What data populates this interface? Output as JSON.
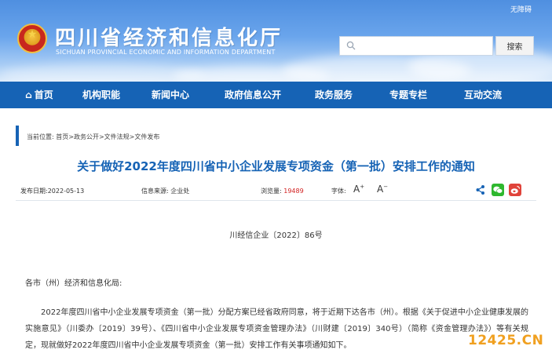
{
  "header": {
    "accessibility": "无障碍",
    "site_title": "四川省经济和信息化厅",
    "site_subtitle": "SICHUAN PROVINCIAL ECONOMIC AND INFORMATION DEPARTMENT",
    "search_placeholder": "",
    "search_button": "搜索"
  },
  "nav": {
    "items": [
      {
        "label": "首页",
        "icon": "home-icon"
      },
      {
        "label": "机构职能"
      },
      {
        "label": "新闻中心"
      },
      {
        "label": "政府信息公开"
      },
      {
        "label": "政务服务"
      },
      {
        "label": "专题专栏"
      },
      {
        "label": "互动交流"
      }
    ]
  },
  "breadcrumb": {
    "prefix": "当前位置:",
    "items": [
      "首页",
      "政务公开",
      "文件法规",
      "文件发布"
    ],
    "separator": ">"
  },
  "article": {
    "title": "关于做好2022年度四川省中小企业发展专项资金（第一批）安排工作的通知",
    "publish_label": "发布日期:",
    "publish_date": "2022-05-13",
    "source_label": "信息来源:",
    "source": "企业处",
    "views_label": "浏览量:",
    "views": "19489",
    "font_label": "字体:",
    "font_increase": "A",
    "font_decrease": "A",
    "doc_number": "川经信企业〔2022〕86号",
    "salutation": "各市（州）经济和信息化局:",
    "body": "2022年度四川省中小企业发展专项资金（第一批）分配方案已经省政府同意，将于近期下达各市（州）。根据《关于促进中小企业健康发展的实施意见》（川委办〔2019〕39号）、《四川省中小企业发展专项资金管理办法》（川财建〔2019〕340号）（简称《资金管理办法》）等有关规定，现就做好2022年度四川省中小企业发展专项资金（第一批）安排工作有关事项通知如下。"
  },
  "share": {
    "icons": [
      "share-icon",
      "wechat-icon",
      "weibo-icon"
    ],
    "colors": {
      "share": "#1663b5",
      "wechat": "#2eb82e",
      "weibo": "#e0433a"
    }
  },
  "watermark": "12425.CN",
  "colors": {
    "nav": "#1663b5",
    "title": "#1663b5",
    "views": "#d22020"
  }
}
